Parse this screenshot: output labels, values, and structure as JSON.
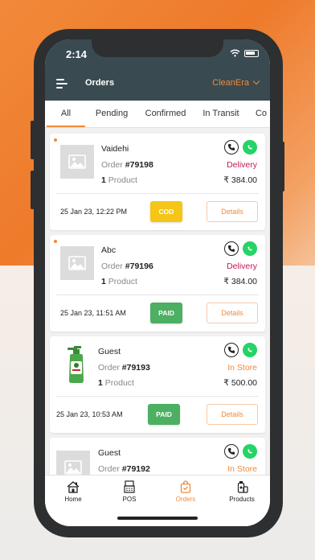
{
  "status_bar": {
    "time": "2:14"
  },
  "appbar": {
    "title": "Orders",
    "store": "CleanEra"
  },
  "tabs": [
    {
      "label": "All",
      "active": true
    },
    {
      "label": "Pending",
      "active": false
    },
    {
      "label": "Confirmed",
      "active": false
    },
    {
      "label": "In Transit",
      "active": false
    },
    {
      "label": "Co",
      "active": false
    }
  ],
  "orders": [
    {
      "name": "Vaidehi",
      "order_prefix": "Order ",
      "order_no": "#79198",
      "qty": "1",
      "qty_label": " Product",
      "type": "Delivery",
      "price": "₹ 384.00",
      "date": "25 Jan 23, 12:22 PM",
      "payment": "COD",
      "details": "Details",
      "unread": true,
      "thumb": "placeholder"
    },
    {
      "name": "Abc",
      "order_prefix": "Order ",
      "order_no": "#79196",
      "qty": "1",
      "qty_label": " Product",
      "type": "Delivery",
      "price": "₹ 384.00",
      "date": "25 Jan 23, 11:51 AM",
      "payment": "PAID",
      "details": "Details",
      "unread": true,
      "thumb": "placeholder"
    },
    {
      "name": "Guest",
      "order_prefix": "Order ",
      "order_no": "#79193",
      "qty": "1",
      "qty_label": " Product",
      "type": "In Store",
      "price": "₹ 500.00",
      "date": "25 Jan 23, 10:53 AM",
      "payment": "PAID",
      "details": "Details",
      "unread": false,
      "thumb": "product"
    },
    {
      "name": "Guest",
      "order_prefix": "Order ",
      "order_no": "#79192",
      "qty": "",
      "qty_label": "",
      "type": "In Store",
      "price": "",
      "date": "",
      "payment": "",
      "details": "",
      "unread": false,
      "thumb": "placeholder"
    }
  ],
  "colors": {
    "accent": "#f08a3a",
    "delivery": "#c2185b",
    "instore": "#f08a3a",
    "cod": "#f5c518",
    "paid": "#4caf62"
  },
  "nav": [
    {
      "label": "Home",
      "icon": "home-icon"
    },
    {
      "label": "POS",
      "icon": "pos-icon"
    },
    {
      "label": "Orders",
      "icon": "orders-bag-icon",
      "active": true
    },
    {
      "label": "Products",
      "icon": "products-icon"
    }
  ]
}
